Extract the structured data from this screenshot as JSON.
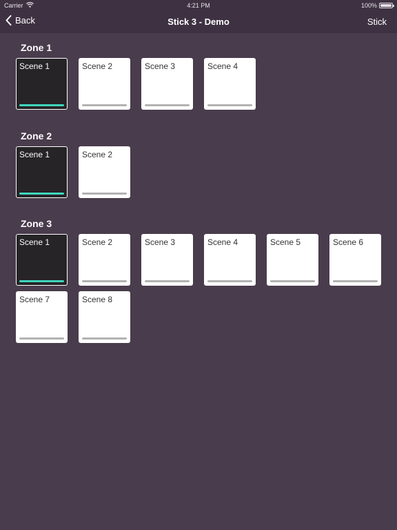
{
  "status_bar": {
    "carrier": "Carrier",
    "time": "4:21 PM",
    "battery": "100%"
  },
  "nav": {
    "back_label": "Back",
    "title": "Stick 3 - Demo",
    "right_label": "Stick"
  },
  "colors": {
    "background": "#493c4c",
    "nav_background": "#3e3242",
    "active_tile": "#262426",
    "active_indicator": "#3fd7bd",
    "inactive_indicator": "#b2b2b2"
  },
  "zones": [
    {
      "title": "Zone 1",
      "scenes": [
        {
          "label": "Scene 1",
          "active": true
        },
        {
          "label": "Scene 2",
          "active": false
        },
        {
          "label": "Scene 3",
          "active": false
        },
        {
          "label": "Scene 4",
          "active": false
        }
      ]
    },
    {
      "title": "Zone 2",
      "scenes": [
        {
          "label": "Scene 1",
          "active": true
        },
        {
          "label": "Scene 2",
          "active": false
        }
      ]
    },
    {
      "title": "Zone 3",
      "scenes": [
        {
          "label": "Scene 1",
          "active": true
        },
        {
          "label": "Scene 2",
          "active": false
        },
        {
          "label": "Scene 3",
          "active": false
        },
        {
          "label": "Scene 4",
          "active": false
        },
        {
          "label": "Scene 5",
          "active": false
        },
        {
          "label": "Scene 6",
          "active": false
        },
        {
          "label": "Scene 7",
          "active": false
        },
        {
          "label": "Scene 8",
          "active": false
        }
      ]
    }
  ]
}
